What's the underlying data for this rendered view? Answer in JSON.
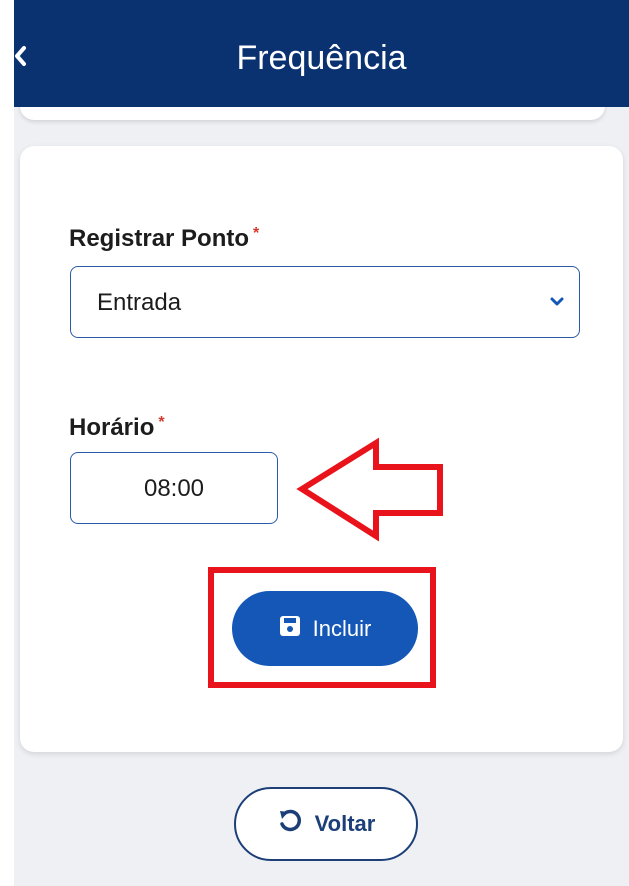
{
  "header": {
    "title": "Frequência",
    "back_icon": "chevron-left-icon"
  },
  "form": {
    "registrar": {
      "label": "Registrar Ponto",
      "required_mark": "*",
      "value": "Entrada"
    },
    "horario": {
      "label": "Horário",
      "required_mark": "*",
      "value": "08:00"
    }
  },
  "actions": {
    "incluir_label": "Incluir",
    "incluir_icon": "save-icon",
    "voltar_label": "Voltar",
    "voltar_icon": "undo-icon"
  },
  "colors": {
    "header_bg": "#0b3270",
    "primary": "#1457b6",
    "annotation_red": "#e8131b",
    "required": "#d63a2f"
  }
}
